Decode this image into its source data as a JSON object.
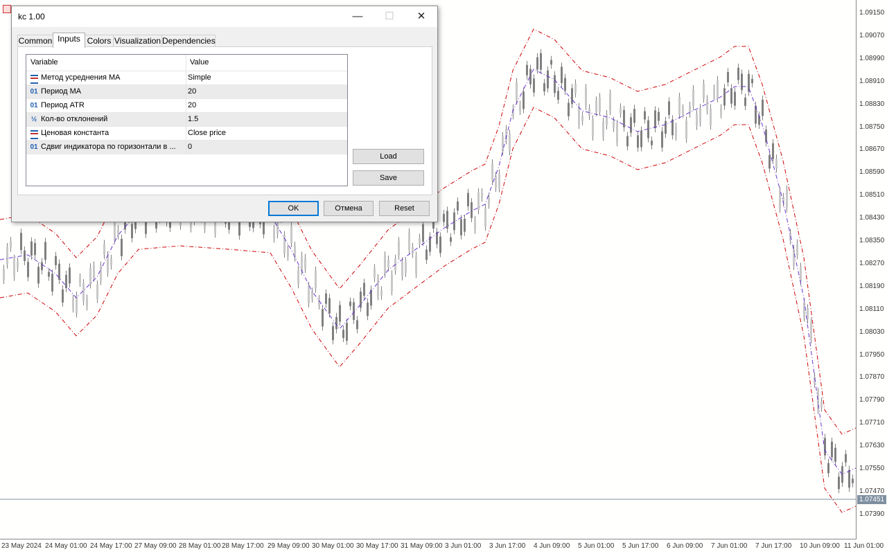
{
  "chart": {
    "price_ticks": [
      "1.09150",
      "1.09070",
      "1.08990",
      "1.08910",
      "1.08830",
      "1.08750",
      "1.08670",
      "1.08590",
      "1.08510",
      "1.08430",
      "1.08350",
      "1.08270",
      "1.08190",
      "1.08110",
      "1.08030",
      "1.07950",
      "1.07870",
      "1.07790",
      "1.07710",
      "1.07630",
      "1.07550",
      "1.07470",
      "1.07390"
    ],
    "current_price": "1.07451",
    "date_ticks": [
      "23 May 2024",
      "24 May 01:00",
      "24 May 17:00",
      "27 May 09:00",
      "28 May 01:00",
      "28 May 17:00",
      "29 May 09:00",
      "30 May 01:00",
      "30 May 17:00",
      "31 May 09:00",
      "3 Jun 01:00",
      "3 Jun 17:00",
      "4 Jun 09:00",
      "5 Jun 01:00",
      "5 Jun 17:00",
      "6 Jun 09:00",
      "7 Jun 01:00",
      "7 Jun 17:00",
      "10 Jun 09:00",
      "11 Jun 01:00"
    ],
    "colors": {
      "upper_band": "#cc0000",
      "middle_line": "#6633cc",
      "lower_band": "#cc0000",
      "candles": "#808080",
      "price_line": "#7f8fa0"
    }
  },
  "dialog": {
    "title": "kc 1.00",
    "tabs": [
      "Common",
      "Inputs",
      "Colors",
      "Visualization",
      "Dependencies"
    ],
    "active_tab": "Inputs",
    "grid": {
      "headers": [
        "Variable",
        "Value"
      ],
      "rows": [
        {
          "icon": "enum-icon",
          "name": "Метод усреднения МА",
          "value": "Simple"
        },
        {
          "icon": "int-icon",
          "name": "Период МА",
          "value": "20"
        },
        {
          "icon": "int-icon",
          "name": "Период ATR",
          "value": "20"
        },
        {
          "icon": "fraction-icon",
          "name": "Кол-во отклонений",
          "value": "1.5"
        },
        {
          "icon": "enum-icon",
          "name": "Ценовая константа",
          "value": "Close price"
        },
        {
          "icon": "int-icon",
          "name": "Сдвиг индикатора по горизонтали в ...",
          "value": "0"
        }
      ]
    },
    "buttons": {
      "load": "Load",
      "save": "Save",
      "ok": "OK",
      "cancel": "Отмена",
      "reset": "Reset"
    }
  }
}
